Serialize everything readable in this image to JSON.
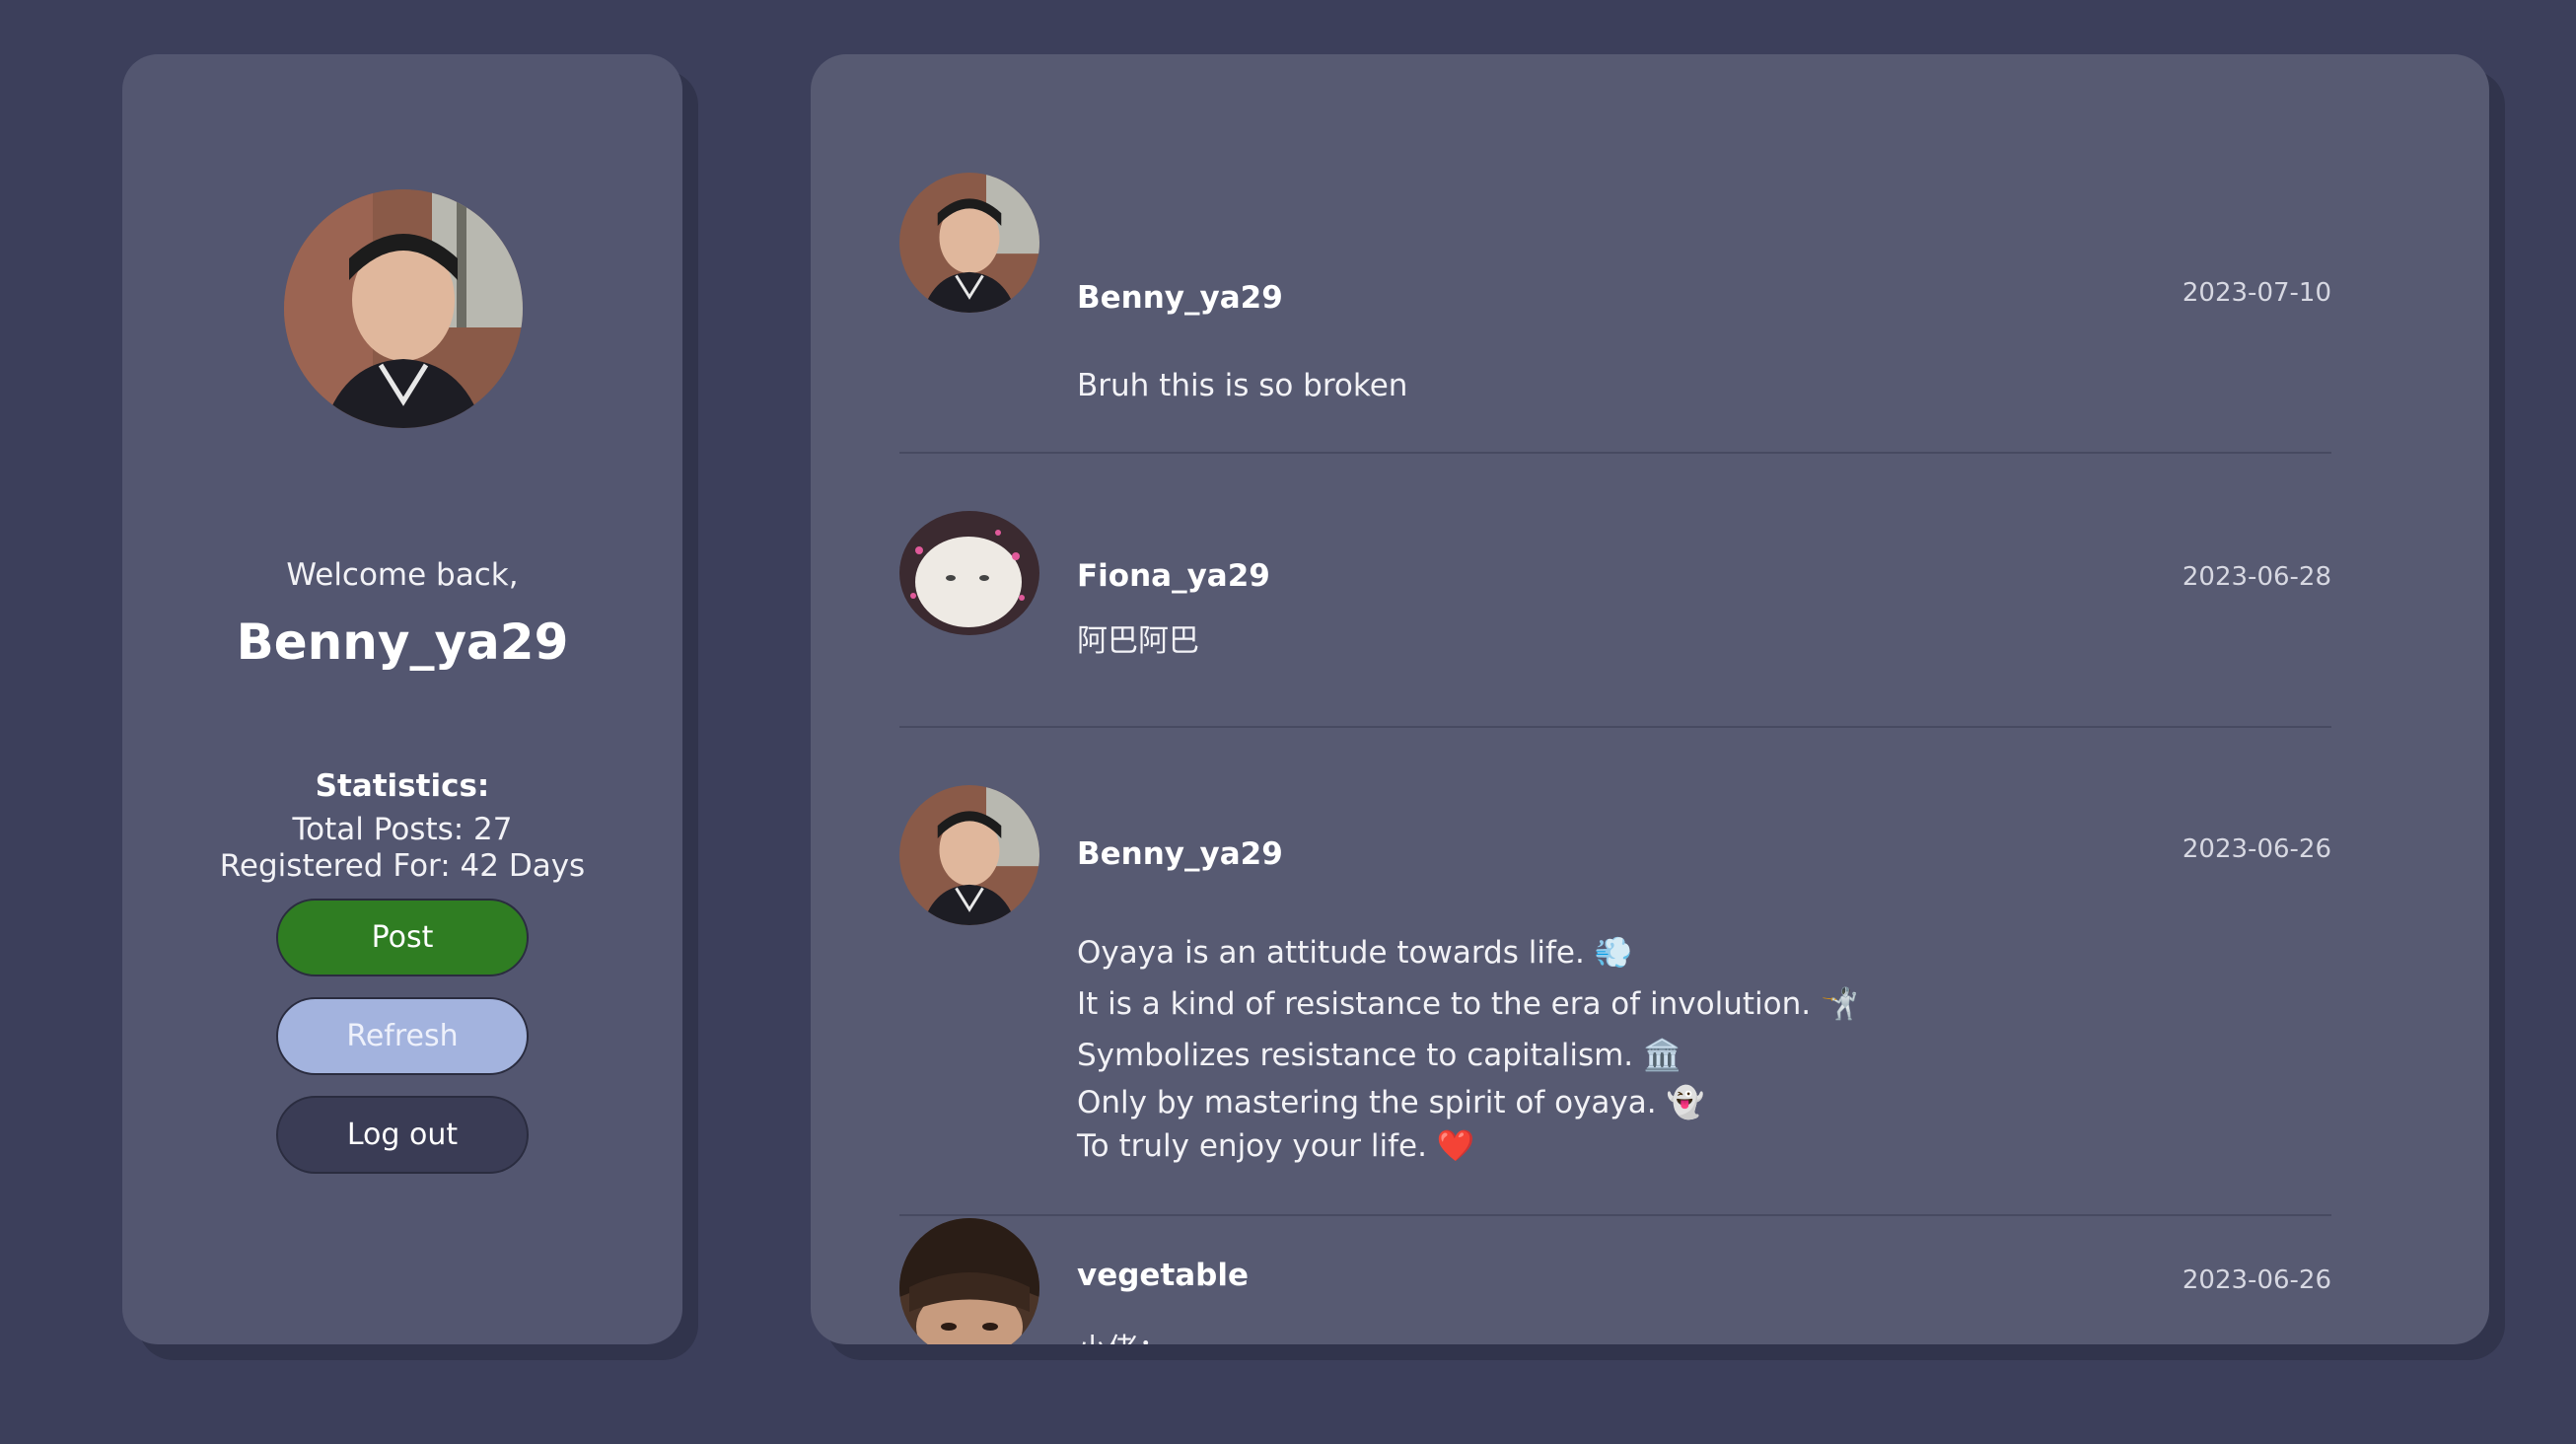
{
  "sidebar": {
    "welcome": "Welcome back,",
    "username": "Benny_ya29",
    "stats_title": "Statistics:",
    "total_posts": "Total Posts: 27",
    "registered_for": "Registered For: 42 Days",
    "buttons": {
      "post": "Post",
      "refresh": "Refresh",
      "logout": "Log out"
    }
  },
  "feed": {
    "posts": [
      {
        "author": "Benny_ya29",
        "date": "2023-07-10",
        "lines": [
          "Bruh this is so broken"
        ]
      },
      {
        "author": "Fiona_ya29",
        "date": "2023-06-28",
        "lines": [
          "阿巴阿巴"
        ]
      },
      {
        "author": "Benny_ya29",
        "date": "2023-06-26",
        "lines": [
          "Oyaya is an attitude towards life. 💨",
          "It is a kind of resistance to the era of involution. 🤺",
          "Symbolizes resistance to capitalism. 🏛️",
          "Only by mastering the spirit of oyaya. 👻",
          "To truly enjoy your life. ❤️"
        ]
      },
      {
        "author": "vegetable",
        "date": "2023-06-26",
        "lines": [
          "小佬："
        ]
      }
    ]
  },
  "colors": {
    "background": "#3c3f5b",
    "panel": "#535670",
    "post_button": "#2f7d22",
    "refresh_button": "#a3b3de",
    "logout_button": "#3a3c55"
  }
}
